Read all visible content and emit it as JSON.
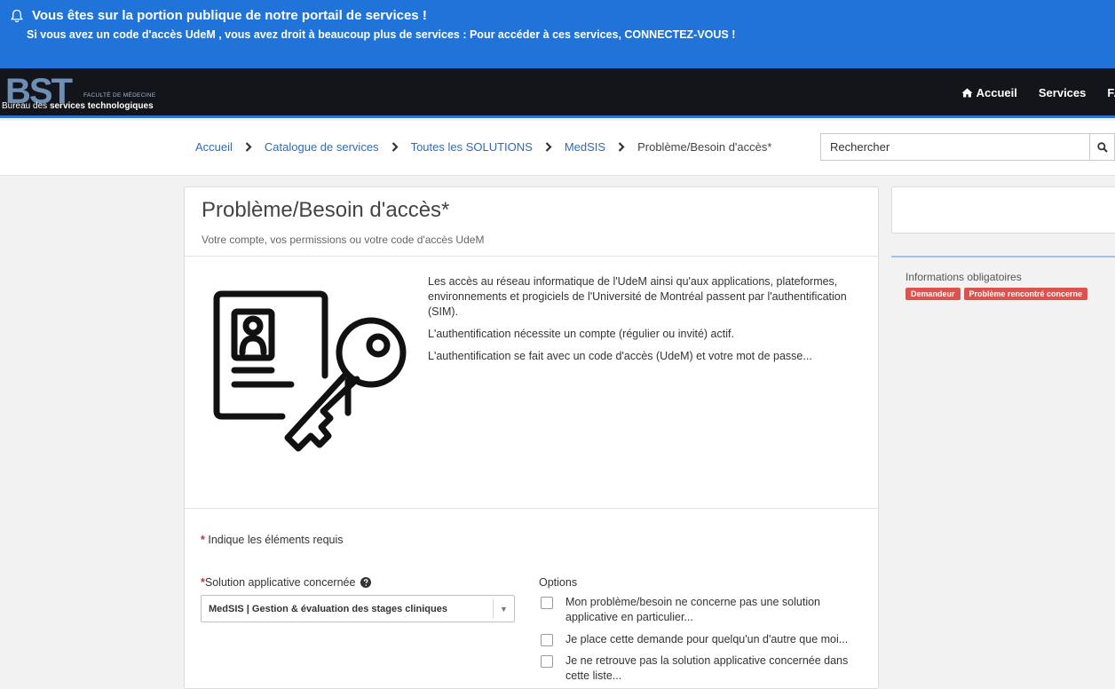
{
  "banner": {
    "title": "Vous êtes sur la portion publique de notre portail de services !",
    "subtitle": "Si vous avez un code d'accès UdeM , vous avez droit à beaucoup plus de services : Pour accéder à ces services, CONNECTEZ-VOUS !"
  },
  "header": {
    "logo_text": "BST",
    "logo_faculty": "FACULTÉ DE MÉDECINE",
    "logo_bureau_prefix": "Bureau des ",
    "logo_bureau_bold": "services technologiques",
    "nav": {
      "home": "Accueil",
      "services": "Services",
      "faq": "FA"
    }
  },
  "breadcrumb": {
    "items": [
      "Accueil",
      "Catalogue de services",
      "Toutes les SOLUTIONS",
      "MedSIS"
    ],
    "current": "Problème/Besoin d'accès*"
  },
  "search": {
    "placeholder": "Rechercher"
  },
  "card": {
    "title": "Problème/Besoin d'accès*",
    "subtitle": "Votre compte, vos permissions ou votre code d'accès UdeM",
    "paragraphs": [
      "Les accès au réseau informatique de l'UdeM ainsi qu'aux applications, plateformes, environnements et progiciels de l'Université de Montréal passent par l'authentification (SIM).",
      "L'authentification nécessite un compte (régulier ou invité) actif.",
      "L'authentification se fait avec un code d'accès (UdeM) et votre mot de passe..."
    ]
  },
  "form": {
    "required_star": "*",
    "required_note": "Indique les éléments requis",
    "solution_label": "Solution applicative concernée",
    "solution_value": "MedSIS | Gestion & évaluation des stages cliniques",
    "options_title": "Options",
    "options": [
      "Mon problème/besoin ne concerne pas une solution applicative en particulier...",
      "Je place cette demande pour quelqu'un d'autre que moi...",
      "Je ne retrouve pas la solution applicative concernée dans cette liste..."
    ]
  },
  "sidebar": {
    "info_title": "Informations obligatoires",
    "badges": [
      "Demandeur",
      "Problème rencontré concerne"
    ],
    "badge_color": "#d9534f"
  },
  "colors": {
    "banner": "#1f73d9",
    "header": "#13151b",
    "link": "#2a6bc1",
    "accent_line": "#2f6fcf"
  }
}
